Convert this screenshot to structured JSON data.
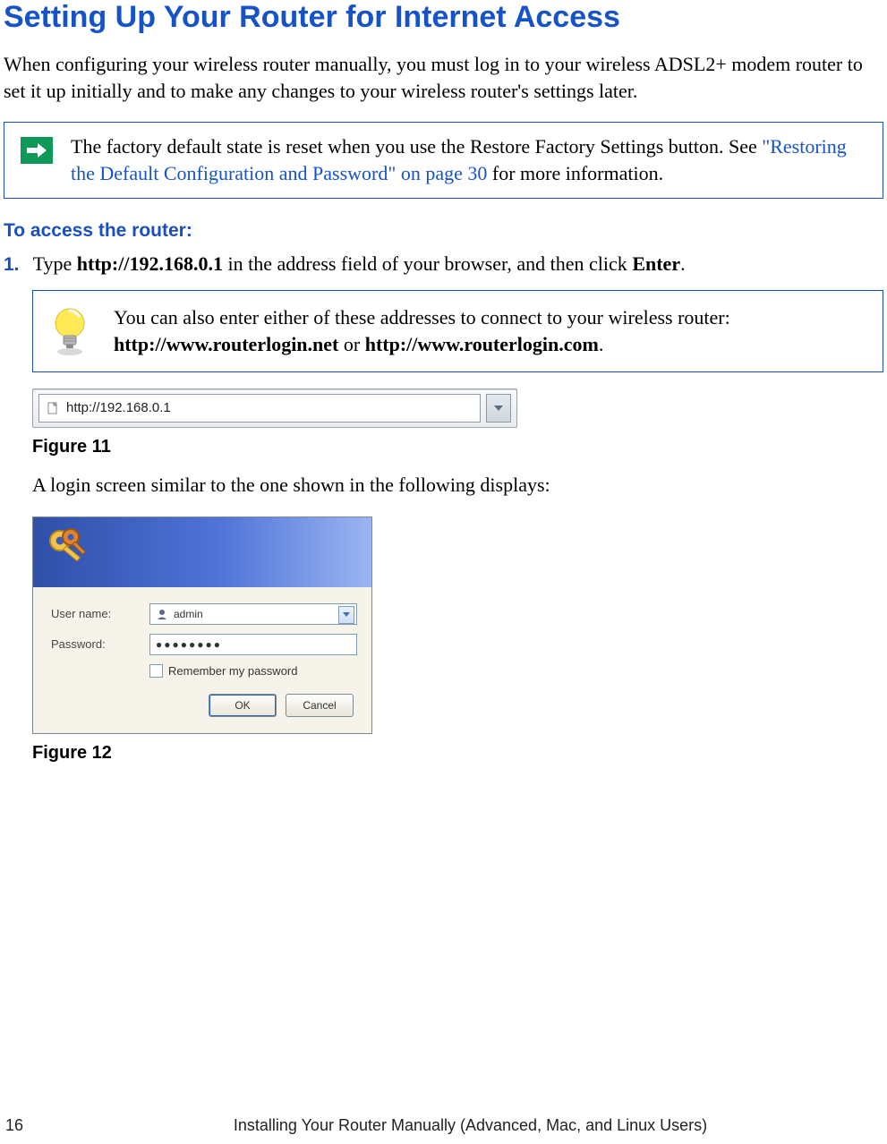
{
  "heading": "Setting Up Your Router for Internet Access",
  "intro": "When configuring your wireless router manually, you must log in to your wireless ADSL2+ modem router to set it up initially and to make any changes to your wireless router's settings later.",
  "note": {
    "part1": "The factory default state is reset when you use the Restore Factory Settings button. See ",
    "link": "\"Restoring the Default Configuration and Password\" on page 30",
    "part2": " for more information."
  },
  "subheading": "To access the router:",
  "step1": {
    "num": "1.",
    "pre": "Type ",
    "url": "http://192.168.0.1",
    "mid": " in the address field of your browser, and then click ",
    "action": "Enter",
    "post": "."
  },
  "tip": {
    "line1": "You can also enter either of these addresses to connect to your wireless router: ",
    "addr1": "http://www.routerlogin.net",
    "or": " or ",
    "addr2": "http://www.routerlogin.com",
    "end": "."
  },
  "address_bar_value": "http://192.168.0.1",
  "figure11_caption": "Figure 11",
  "login_intro": "A login screen similar to the one shown in the following displays:",
  "login_dialog": {
    "username_label": "User name:",
    "username_value": "admin",
    "password_label": "Password:",
    "password_value": "●●●●●●●●",
    "remember_label": "Remember my password",
    "ok": "OK",
    "cancel": "Cancel"
  },
  "figure12_caption": "Figure 12",
  "footer": {
    "page_number": "16",
    "chapter_title": "Installing Your Router Manually (Advanced, Mac, and Linux Users)"
  }
}
